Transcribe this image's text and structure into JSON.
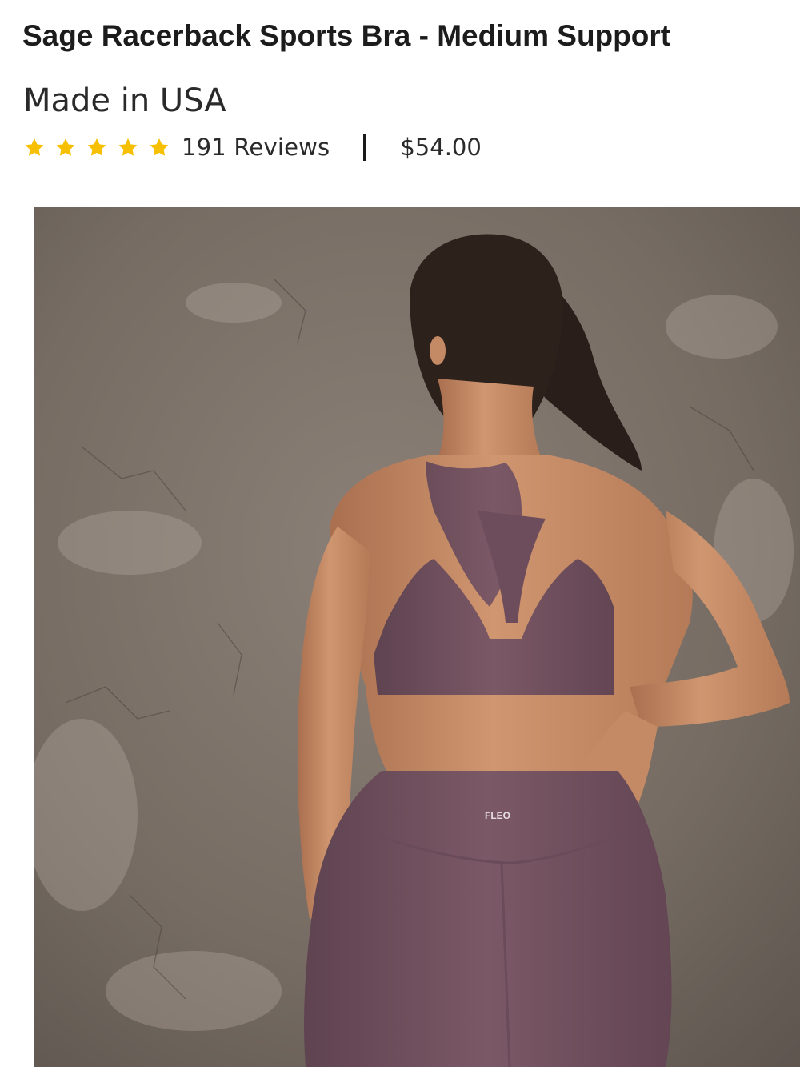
{
  "product": {
    "title": "Sage Racerback Sports Bra - Medium Support",
    "origin": "Made in USA",
    "rating": {
      "stars": 5,
      "max": 5,
      "color": "#f6c000"
    },
    "reviews_label": "191 Reviews",
    "price": "$54.00"
  },
  "image": {
    "brand_mark": "FLEO",
    "palette": {
      "wall": "#7d736a",
      "garment": "#7b5866",
      "skin": "#c98f6a",
      "hair": "#2a1e1a"
    }
  }
}
